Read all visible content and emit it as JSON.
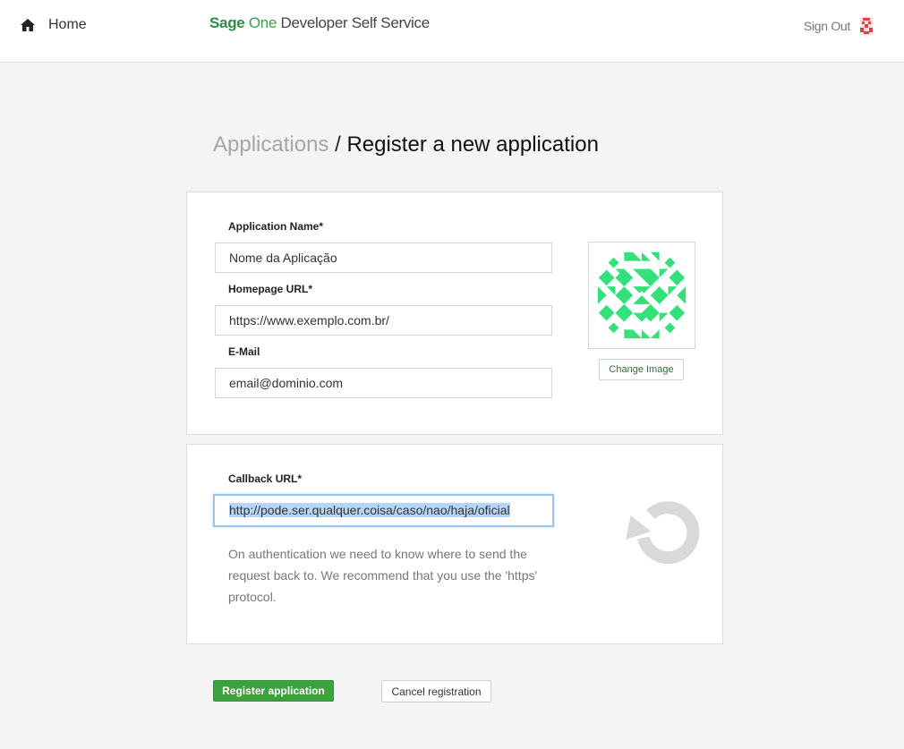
{
  "header": {
    "home_label": "Home",
    "brand_sage": "Sage",
    "brand_one": "One",
    "brand_rest": "Developer Self Service",
    "signout_label": "Sign Out",
    "home_icon": "home-icon",
    "avatar_icon": "user-avatar-icon"
  },
  "breadcrumb": {
    "parent": "Applications",
    "separator": " / ",
    "current": "Register a new application"
  },
  "form": {
    "app_name": {
      "label": "Application Name*",
      "value": "Nome da Aplicação"
    },
    "homepage_url": {
      "label": "Homepage URL*",
      "value": "https://www.exemplo.com.br/"
    },
    "email": {
      "label": "E-Mail",
      "value": "email@dominio.com"
    },
    "change_image_label": "Change Image",
    "callback_url": {
      "label": "Callback URL*",
      "value": "http://pode.ser.qualquer.coisa/caso/nao/haja/oficial",
      "help": "On authentication we need to know where to send the request back to. We recommend that you use the 'https' protocol."
    },
    "refresh_icon": "refresh-icon",
    "app_image_icon": "identicon-image"
  },
  "actions": {
    "register_label": "Register application",
    "cancel_label": "Cancel registration"
  },
  "colors": {
    "brand_green": "#2f8a45",
    "identicon_green": "#33e07a",
    "register_green": "#3ea03f",
    "focus_blue": "#9cc3ea"
  }
}
